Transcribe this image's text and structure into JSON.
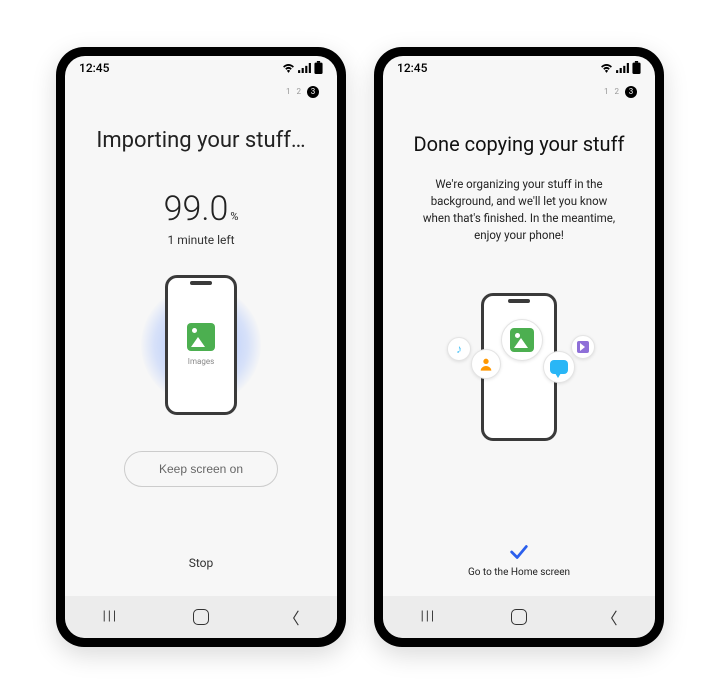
{
  "status": {
    "time": "12:45"
  },
  "steps": {
    "s1": "1",
    "s2": "2",
    "s3": "3"
  },
  "left": {
    "title": "Importing your stuff…",
    "percent": "99.0",
    "percent_unit": "%",
    "time_left": "1 minute left",
    "art_label": "Images",
    "keep_screen_label": "Keep screen on",
    "stop_label": "Stop"
  },
  "right": {
    "title": "Done copying your stuff",
    "subtitle": "We're organizing your stuff in the background, and we'll let you know when that's finished. In the meantime, enjoy your phone!",
    "home_label": "Go to the Home screen"
  }
}
